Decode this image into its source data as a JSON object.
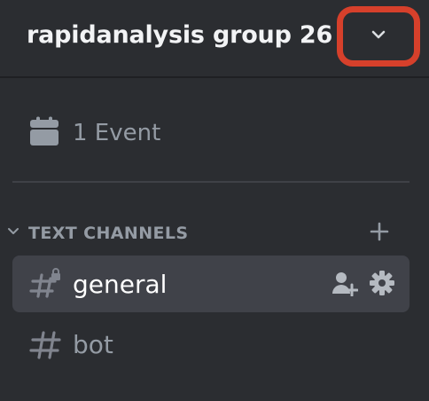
{
  "server": {
    "name": "rapidanalysis group 26",
    "dropdown_icon": "chevron-down-icon",
    "highlight_color": "#d6402b"
  },
  "events": {
    "label": "1 Event",
    "icon": "calendar-icon"
  },
  "category": {
    "label": "TEXT CHANNELS",
    "collapse_icon": "chevron-down-icon",
    "add_icon": "plus-icon"
  },
  "channels": [
    {
      "name": "general",
      "active": true,
      "icon": "hash-lock-icon",
      "actions": [
        "invite-icon",
        "gear-icon"
      ]
    },
    {
      "name": "bot",
      "active": false,
      "icon": "hash-icon"
    }
  ],
  "colors": {
    "background": "#2b2d31",
    "active_channel": "#404249",
    "muted_text": "#949ba4",
    "bright_text": "#f2f3f5"
  }
}
